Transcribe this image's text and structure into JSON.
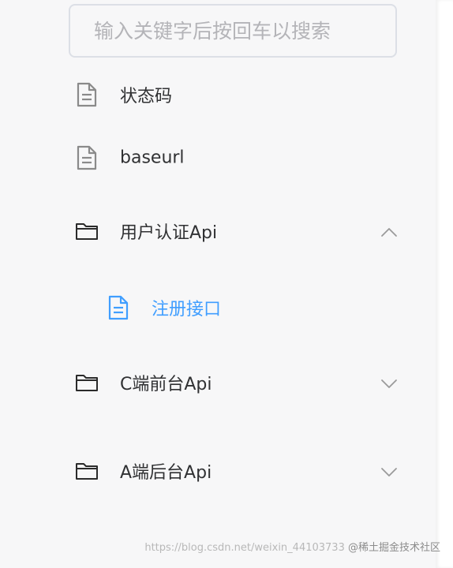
{
  "search": {
    "placeholder": "输入关键字后按回车以搜索",
    "value": ""
  },
  "tree": {
    "items": [
      {
        "label": "状态码",
        "type": "document"
      },
      {
        "label": "baseurl",
        "type": "document"
      },
      {
        "label": "用户认证Api",
        "type": "folder",
        "expanded": true
      },
      {
        "label": "注册接口",
        "type": "document",
        "active": true
      },
      {
        "label": "C端前台Api",
        "type": "folder",
        "expanded": false
      },
      {
        "label": "A端后台Api",
        "type": "folder",
        "expanded": false
      }
    ]
  },
  "colors": {
    "active": "#409eff",
    "text": "#303133",
    "icon": "#8a8a8a",
    "background": "#f7f7f8"
  },
  "watermark": {
    "url_text": "https://blog.csdn.net/weixin_44103733",
    "brand": "@稀土掘金技术社区"
  }
}
